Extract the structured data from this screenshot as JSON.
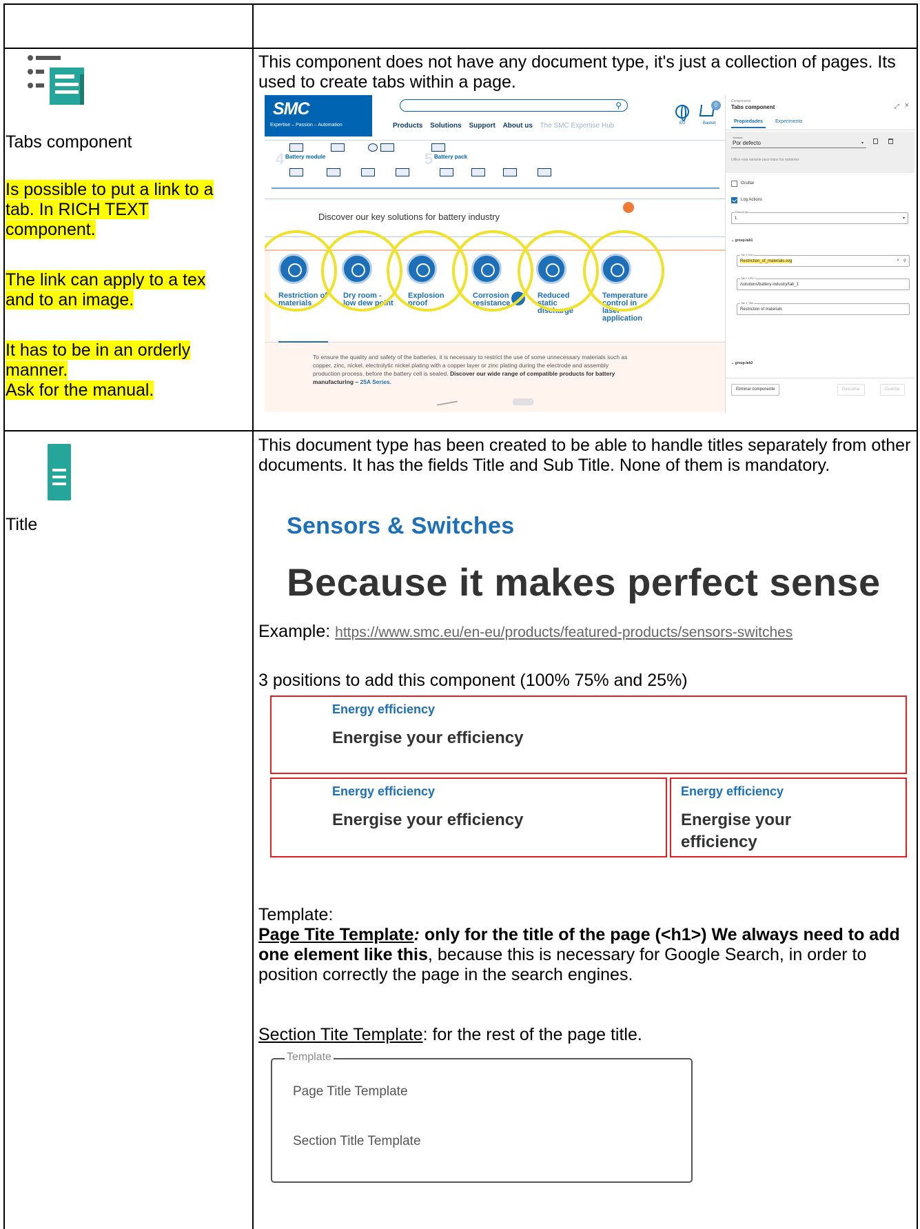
{
  "rows": [
    {
      "left": {
        "icon": "list-tabs-icon",
        "name": "Tabs component",
        "notes": [
          "Is possible to put a link to a tab. In RICH TEXT component.",
          "The link can  apply to a tex and to an image.",
          "It has to be in an orderly manner.",
          "Ask for the manual."
        ]
      },
      "right": {
        "description": "This component does not have any document type, it's just a collection of pages. Its used to create tabs within a page.",
        "screenshot": {
          "site": {
            "logo": "SMC",
            "tagline": "Expertise – Passion – Automation",
            "nav": [
              "Products",
              "Solutions",
              "Support",
              "About us",
              "The SMC Expertise Hub"
            ],
            "globe_label": "EU",
            "basket_label": "Basket",
            "basket_count": "0",
            "strip_labels": [
              "Battery module",
              "Battery pack"
            ],
            "strip_numbers": [
              "4",
              "5"
            ],
            "discover": "Discover our key solutions for battery industry",
            "tabs": [
              {
                "label": "Restriction of materials",
                "icon": "no-materials-icon"
              },
              {
                "label": "Dry room - low dew point",
                "icon": "thermometer-icon"
              },
              {
                "label": "Explosion proof",
                "icon": "ex-icon"
              },
              {
                "label": "Corrosion resistance",
                "icon": "corrosion-icon"
              },
              {
                "label": "Reduced static discharge",
                "icon": "static-icon"
              },
              {
                "label": "Temperature control in laser application",
                "icon": "laser-icon"
              }
            ],
            "paragraph": "To ensure the quality and safety of the batteries, it is necessary to restrict the use of some unnecessary materials such as copper, zinc, nickel, electrolytic nickel plating with a copper layer or zinc plating during the electrode and assembly production process, before the battery cell is sealed.",
            "paragraph_bold": "Discover our wide range of compatible products for battery manufacturing –",
            "paragraph_link": "25A Series."
          },
          "panel": {
            "small": "Componente",
            "title": "Tabs component",
            "tabs": [
              "Propiedades",
              "Experimento"
            ],
            "variant_label": "Variante",
            "variant_value": "Por defecto",
            "variant_note": "Utilice esta variante para todos los visitantes",
            "checks": [
              {
                "label": "Ocultar",
                "checked": false
              },
              {
                "label": "Log Actions",
                "checked": true
              }
            ],
            "default_tab_label": "Default tab",
            "default_tab_value": "1",
            "group1": "group.tab1",
            "tab1_icon_label": "Tab 1 Icon",
            "tab1_icon_value": "Restriction_of_materials.svg",
            "tab1_url_label": "Tab 1 URL *",
            "tab1_url_value": "/solutions/battery-industry/tab_1",
            "tab1_title_label": "Tab 1 Title",
            "tab1_title_value": "Restriction of materials",
            "group2": "group.tab2",
            "btn_delete": "Eliminar componente",
            "btn_discard": "Descartar",
            "btn_save": "Guardar"
          }
        }
      }
    },
    {
      "left": {
        "icon": "document-icon",
        "name": "Title"
      },
      "right": {
        "description": "This document type has been created to be able to handle titles separately from other documents. It has the fields Title and Sub Title. None of them is mandatory.",
        "sample_subtitle": "Sensors & Switches",
        "sample_title": "Because it makes perfect sense",
        "example_label": "Example: ",
        "example_link": "https://www.smc.eu/en-eu/products/featured-products/sensors-switches",
        "positions_text": "3 positions to add this component (100% 75% and 25%)",
        "energy_small": "Energy efficiency",
        "energy_big": "Energise your efficiency",
        "template_heading": "Template:",
        "page_template_name": "Page Tite Template",
        "page_template_colon": ":",
        "page_template_bold": " only for the title of the page (<h1>) We always need to add one element like this",
        "page_template_rest": ", because this is necessary for Google Search, in order to position correctly the page in the search engines.",
        "section_template_name": "Section Tite Template",
        "section_template_rest": ": for the rest of the page title.",
        "template_box_label": "Template",
        "template_options": [
          "Page Title Template",
          "Section Title Template"
        ]
      }
    }
  ]
}
